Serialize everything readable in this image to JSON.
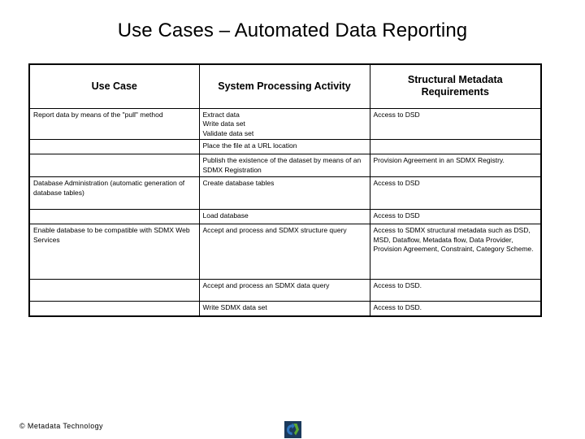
{
  "slide": {
    "title": "Use Cases – Automated Data Reporting"
  },
  "table": {
    "headers": [
      "Use Case",
      "System Processing Activity",
      "Structural Metadata Requirements"
    ],
    "rows": [
      {
        "use_case": "Report data by means of the \"pull\" method",
        "activity": "Extract data\nWrite data set\nValidate data set",
        "activity_lines": [
          "Extract data",
          "Write data set",
          "Validate data set"
        ],
        "requirements": "Access to DSD"
      },
      {
        "use_case": "",
        "activity": "Place the file at a URL location",
        "activity_lines": [
          "Place the file at a URL location"
        ],
        "requirements": ""
      },
      {
        "use_case": "",
        "activity": "Publish the existence of the dataset by means of an SDMX Registration",
        "activity_lines": [
          "Publish the existence of the dataset by means of an SDMX Registration"
        ],
        "requirements": "Provision Agreement in an SDMX Registry."
      },
      {
        "use_case": "Database Administration (automatic generation of database tables)",
        "activity": "Create database tables",
        "activity_lines": [
          "Create database tables"
        ],
        "requirements": "Access to DSD"
      },
      {
        "use_case": "",
        "activity": "Load database",
        "activity_lines": [
          "Load database"
        ],
        "requirements": "Access to DSD"
      },
      {
        "use_case": "Enable database to be compatible with SDMX Web Services",
        "activity": "Accept and process and SDMX structure query",
        "activity_lines": [
          "Accept and process and SDMX structure query"
        ],
        "requirements": "Access to SDMX structural metadata such as DSD, MSD, Dataflow, Metadata flow, Data Provider, Provision Agreement, Constraint, Category Scheme."
      },
      {
        "use_case": "",
        "activity": "Accept and process an SDMX data query",
        "activity_lines": [
          "Accept and process an SDMX data query"
        ],
        "requirements": "Access to DSD."
      },
      {
        "use_case": "",
        "activity": "Write SDMX data set",
        "activity_lines": [
          "Write SDMX data set"
        ],
        "requirements": "Access to DSD."
      }
    ]
  },
  "footer": {
    "copyright": "© Metadata Technology",
    "logo_name": "metadata-technology-logo",
    "logo_colors": {
      "background": "#1b3a5c",
      "blue": "#2f76bf",
      "green": "#5aa832"
    }
  }
}
